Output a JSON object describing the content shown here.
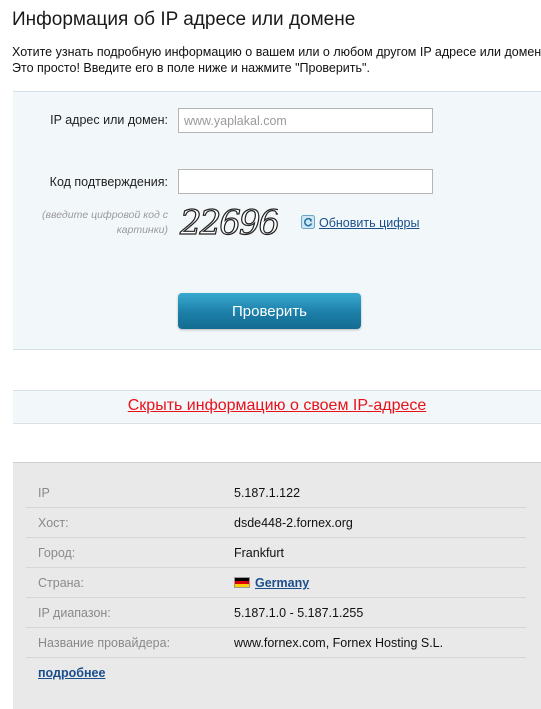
{
  "page": {
    "title": "Информация об IP адресе или домене",
    "intro_line1": "Хотите узнать подробную информацию о вашем или о любом другом IP адресе или домене?",
    "intro_line2": "Это просто! Введите его в поле ниже и нажмите \"Проверить\"."
  },
  "form": {
    "ip_label": "IP адрес или домен:",
    "ip_placeholder": "www.yaplakal.com",
    "ip_value": "",
    "code_label": "Код подтверждения:",
    "code_value": "",
    "captcha_hint": "(введите цифровой код с картинки)",
    "captcha_text": "22696",
    "refresh_label": "Обновить цифры",
    "refresh_icon": "refresh-icon",
    "submit_label": "Проверить"
  },
  "hide_link": "Скрыть информацию о своем IP-адресе",
  "info": {
    "rows": [
      {
        "key": "IP",
        "value": "5.187.1.122"
      },
      {
        "key": "Хост:",
        "value": "dsde448-2.fornex.org"
      },
      {
        "key": "Город:",
        "value": "Frankfurt"
      },
      {
        "key": "Страна:",
        "value": "Germany"
      },
      {
        "key": "IP диапазон:",
        "value": "5.187.1.0 - 5.187.1.255"
      },
      {
        "key": "Название провайдера:",
        "value": "www.fornex.com, Fornex Hosting S.L."
      }
    ],
    "country_flag": "germany-flag-icon",
    "more_label": "подробнее"
  },
  "colors": {
    "button": "#1c7fa8",
    "hide_link": "#e8111a",
    "link": "#1a4f8c",
    "form_bg": "#f2f7f9",
    "info_bg": "#e9e9e9"
  }
}
